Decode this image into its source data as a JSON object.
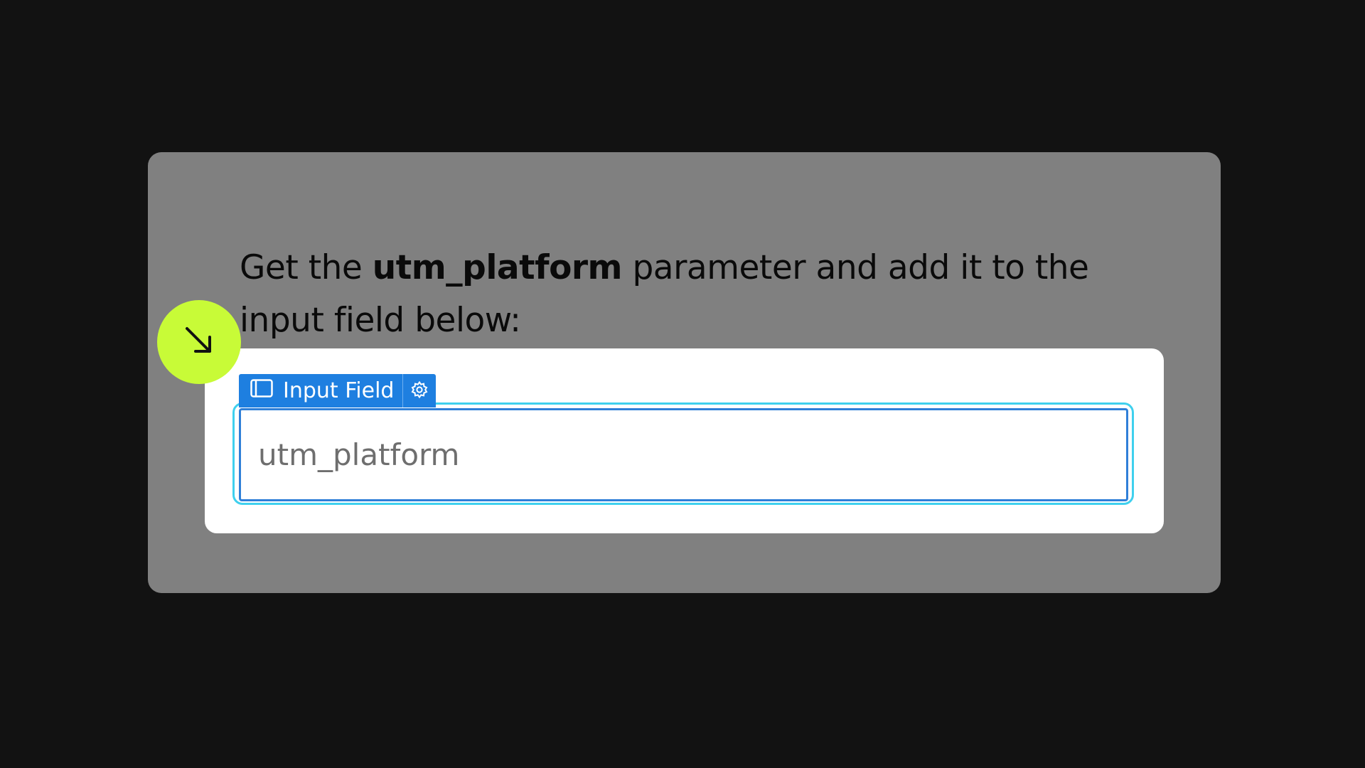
{
  "instruction": {
    "prefix": "Get the ",
    "bold": "utm_platform",
    "suffix": " parameter and add it to the input field below:"
  },
  "input_tag": {
    "label": "Input Field",
    "icon": "panel-icon",
    "settings_icon": "gear-icon"
  },
  "input": {
    "placeholder": "utm_platform",
    "value": ""
  },
  "hotspot": {
    "icon": "arrow-down-right-icon"
  },
  "colors": {
    "background": "#121212",
    "card": "#808080",
    "panel": "#ffffff",
    "accent_blue": "#1e7fe0",
    "focus_ring": "#3fd0ee",
    "hotspot": "#c8fb37"
  }
}
